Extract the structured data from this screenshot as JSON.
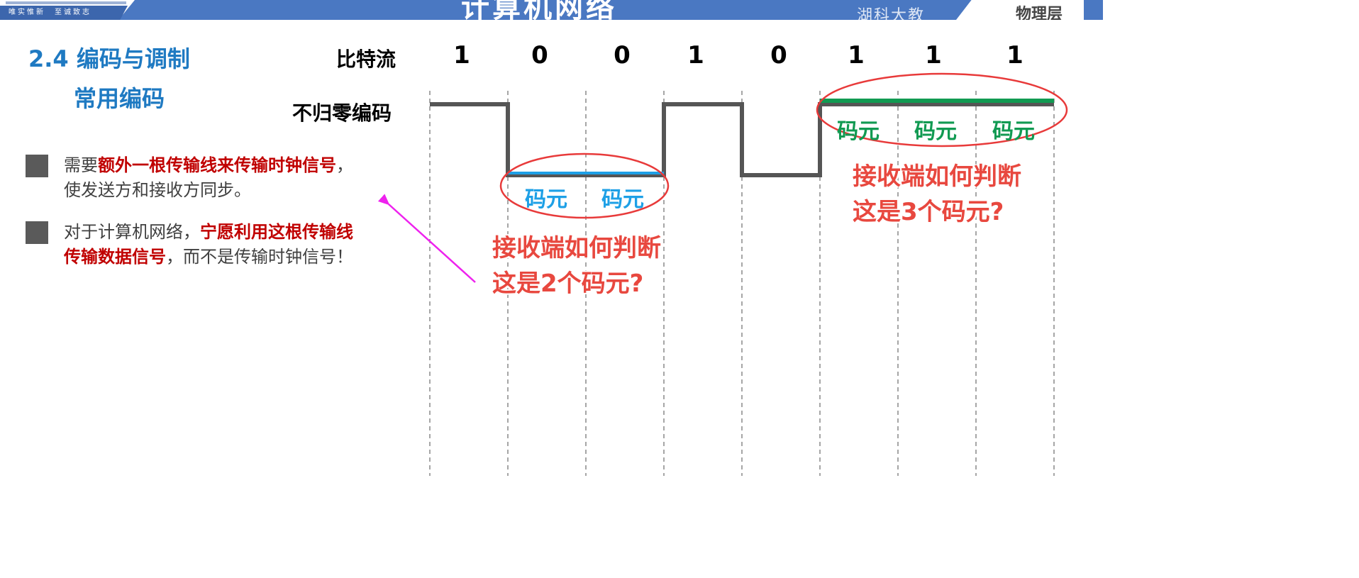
{
  "header": {
    "motto": "唯实惟新　至诚致志",
    "course_title": "计算机网络",
    "university": "湖科大教",
    "chapter": "物理层"
  },
  "section": {
    "title": "2.4 编码与调制",
    "subtitle": "常用编码"
  },
  "bullets": [
    {
      "pre": "需要",
      "highlight": "额外一根传输线来传输时钟信号",
      "post": "，",
      "line2": "使发送方和接收方同步。"
    },
    {
      "pre": "对于计算机网络，",
      "highlight": "宁愿利用这根传输线",
      "line2_highlight": "传输数据信号",
      "line2_post": "，而不是传输时钟信号！"
    }
  ],
  "diagram": {
    "bitstream_label": "比特流",
    "encoding_label": "不归零编码",
    "bits": [
      "1",
      "0",
      "0",
      "1",
      "0",
      "1",
      "1",
      "1"
    ],
    "code_element_label": "码元",
    "note_two": {
      "line1": "接收端如何判断",
      "line2": "这是2个码元?"
    },
    "note_three": {
      "line1": "接收端如何判断",
      "line2": "这是3个码元?"
    }
  },
  "colors": {
    "banner": "#4a78c2",
    "section_title": "#1f7ac2",
    "highlight_red": "#c00000",
    "note_red": "#e8483f",
    "ellipse_red": "#e83a3a",
    "code_blue": "#1ea0e6",
    "code_green": "#119a52",
    "signal_gray": "#555555",
    "arrow_magenta": "#ee22ee"
  }
}
